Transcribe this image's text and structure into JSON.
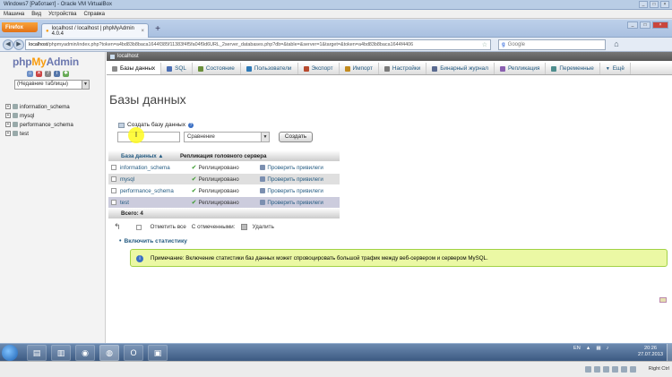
{
  "vbox": {
    "title": "Windows7 [Работает] - Oracle VM VirtualBox",
    "menu": [
      "Машина",
      "Вид",
      "Устройства",
      "Справка"
    ],
    "host_key": "Right Ctrl"
  },
  "browser": {
    "firefox_button": "Firefox",
    "tab_title": "localhost / localhost | phpMyAdmin 4.0.4",
    "url_host": "localhost",
    "url_rest": "/phpmyadmin/index.php?token=a4bd83b8baca1644f385f11383f4f5fa04f9d6URL_2server_databases.php?db=&table=&server=1&target=&token=a4bd83b8baca1644f4406",
    "search_placeholder": "Google"
  },
  "sidebar": {
    "logo": {
      "php": "php",
      "my": "My",
      "admin": "Admin"
    },
    "table_select": "(Недавние таблицы)",
    "databases": [
      {
        "name": "information_schema"
      },
      {
        "name": "mysql"
      },
      {
        "name": "performance_schema"
      },
      {
        "name": "test"
      }
    ]
  },
  "main": {
    "breadcrumb": "localhost",
    "tabs": [
      {
        "label": "Базы данных",
        "color": "#8a8a8a"
      },
      {
        "label": "SQL",
        "color": "#4b6fb5"
      },
      {
        "label": "Состояние",
        "color": "#6a8f3b"
      },
      {
        "label": "Пользователи",
        "color": "#2e7ab8"
      },
      {
        "label": "Экспорт",
        "color": "#b84a2e"
      },
      {
        "label": "Импорт",
        "color": "#c28a1d"
      },
      {
        "label": "Настройки",
        "color": "#7a7a7a"
      },
      {
        "label": "Бинарный журнал",
        "color": "#5a6a90"
      },
      {
        "label": "Репликация",
        "color": "#8a5fb0"
      },
      {
        "label": "Переменные",
        "color": "#4e8d8d"
      },
      {
        "label": "Ещё",
        "color": "#333333"
      }
    ],
    "page_title": "Базы данных",
    "create_label": "Создать базу данных",
    "collation_value": "Сравнение",
    "create_button": "Создать",
    "table": {
      "col_db": "База данных",
      "col_repl": "Репликация головного сервера",
      "rows": [
        {
          "name": "information_schema",
          "repl": "Реплицировано",
          "priv": "Проверить привилеги"
        },
        {
          "name": "mysql",
          "repl": "Реплицировано",
          "priv": "Проверить привилеги"
        },
        {
          "name": "performance_schema",
          "repl": "Реплицировано",
          "priv": "Проверить привилеги"
        },
        {
          "name": "test",
          "repl": "Реплицировано",
          "priv": "Проверить привилеги"
        }
      ],
      "total": "Всего: 4"
    },
    "bulk": {
      "select_all": "Отметить все",
      "with_selected": "С отмеченными:",
      "delete": "Удалить"
    },
    "stats_link": "Включить статистику",
    "notice": "Примечание: Включение статистики баз данных может спровоцировать большой трафик между веб-сервером и сервером MySQL."
  },
  "taskbar": {
    "lang": "EN",
    "time": "20:26",
    "date": "27.07.2013"
  }
}
